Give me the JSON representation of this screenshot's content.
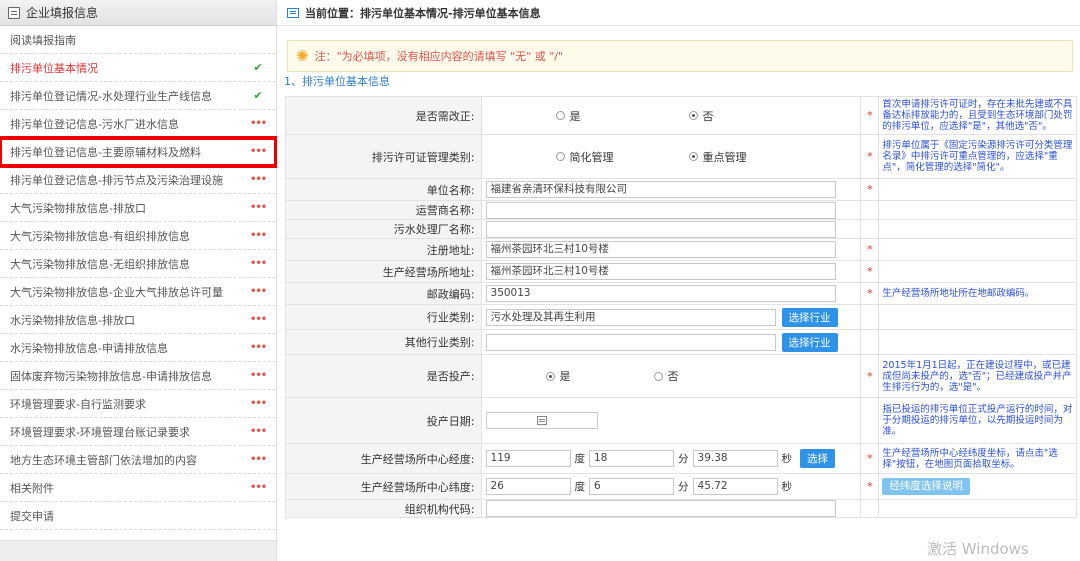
{
  "sidebar": {
    "title": "企业填报信息",
    "items": [
      {
        "label": "阅读填报指南",
        "status": ""
      },
      {
        "label": "排污单位基本情况",
        "status": "✔"
      },
      {
        "label": "排污单位登记情况-水处理行业生产线信息",
        "status": "✔"
      },
      {
        "label": "排污单位登记信息-污水厂进水信息",
        "status": "•••"
      },
      {
        "label": "排污单位登记信息-主要原辅材料及燃料",
        "status": "•••"
      },
      {
        "label": "排污单位登记信息-排污节点及污染治理设施",
        "status": "•••"
      },
      {
        "label": "大气污染物排放信息-排放口",
        "status": "•••"
      },
      {
        "label": "大气污染物排放信息-有组织排放信息",
        "status": "•••"
      },
      {
        "label": "大气污染物排放信息-无组织排放信息",
        "status": "•••"
      },
      {
        "label": "大气污染物排放信息-企业大气排放总许可量",
        "status": "•••"
      },
      {
        "label": "水污染物排放信息-排放口",
        "status": "•••"
      },
      {
        "label": "水污染物排放信息-申请排放信息",
        "status": "•••"
      },
      {
        "label": "固体废弃物污染物排放信息-申请排放信息",
        "status": "•••"
      },
      {
        "label": "环境管理要求-自行监测要求",
        "status": "•••"
      },
      {
        "label": "环境管理要求-环境管理台账记录要求",
        "status": "•••"
      },
      {
        "label": "地方生态环境主管部门依法增加的内容",
        "status": "•••"
      },
      {
        "label": "相关附件",
        "status": "•••"
      },
      {
        "label": "提交申请",
        "status": ""
      }
    ]
  },
  "topbar": {
    "location": "当前位置：排污单位基本情况-排污单位基本信息"
  },
  "notice": {
    "text": "注：\"为必填项，没有相应内容的请填写 \"无\" 或 \"/\""
  },
  "section": {
    "title": "1、排污单位基本信息"
  },
  "form": {
    "need_rectify": {
      "label": "是否需改正:",
      "opt_yes": "是",
      "opt_no": "否",
      "selected": "否",
      "hint": "首次申请排污许可证时，存在未批先建或不具备达标排放能力的，且受到生态环境部门处罚的排污单位，应选择\"是\"，其他选\"否\"。"
    },
    "permit_category": {
      "label": "排污许可证管理类别:",
      "opt_simple": "简化管理",
      "opt_key": "重点管理",
      "selected": "重点管理",
      "hint": "排污单位属于《固定污染源排污许可分类管理名录》中排污许可重点管理的，应选择\"重点\"，简化管理的选择\"简化\"。"
    },
    "unit_name": {
      "label": "单位名称:",
      "value": "福建省亲清环保科技有限公司"
    },
    "operator_name": {
      "label": "运营商名称:",
      "value": ""
    },
    "plant_name": {
      "label": "污水处理厂名称:",
      "value": ""
    },
    "reg_address": {
      "label": "注册地址:",
      "value": "福州茶园环北三村10号楼"
    },
    "site_address": {
      "label": "生产经营场所地址:",
      "value": "福州茶园环北三村10号楼"
    },
    "postcode": {
      "label": "邮政编码:",
      "value": "350013",
      "hint": "生产经营场所地址所在地邮政编码。"
    },
    "industry": {
      "label": "行业类别:",
      "value": "污水处理及其再生利用",
      "button": "选择行业"
    },
    "other_industry": {
      "label": "其他行业类别:",
      "value": "",
      "button": "选择行业"
    },
    "in_production": {
      "label": "是否投产:",
      "opt_yes": "是",
      "opt_no": "否",
      "selected": "是",
      "hint": "2015年1月1日起，正在建设过程中，或已建成但尚未投产的，选\"否\"；已经建成投产并产生排污行为的，选\"是\"。"
    },
    "production_date": {
      "label": "投产日期:",
      "value": "",
      "hint": "指已投运的排污单位正式投产运行的时间，对于分期投运的排污单位，以先期投运时间为准。"
    },
    "longitude": {
      "label": "生产经营场所中心经度:",
      "deg": "119",
      "min": "18",
      "sec": "39.38",
      "button": "选择",
      "hint": "生产经营场所中心经纬度坐标，请点击\"选择\"按钮，在地图页面拾取坐标。"
    },
    "latitude": {
      "label": "生产经营场所中心纬度:",
      "deg": "26",
      "min": "6",
      "sec": "45.72",
      "button": "经纬度选择说明"
    },
    "org_code": {
      "label": "组织机构代码:",
      "value": ""
    }
  },
  "units": {
    "deg": "度",
    "min": "分",
    "sec": "秒"
  },
  "required_mark": "*",
  "watermark": "激活 Windows"
}
